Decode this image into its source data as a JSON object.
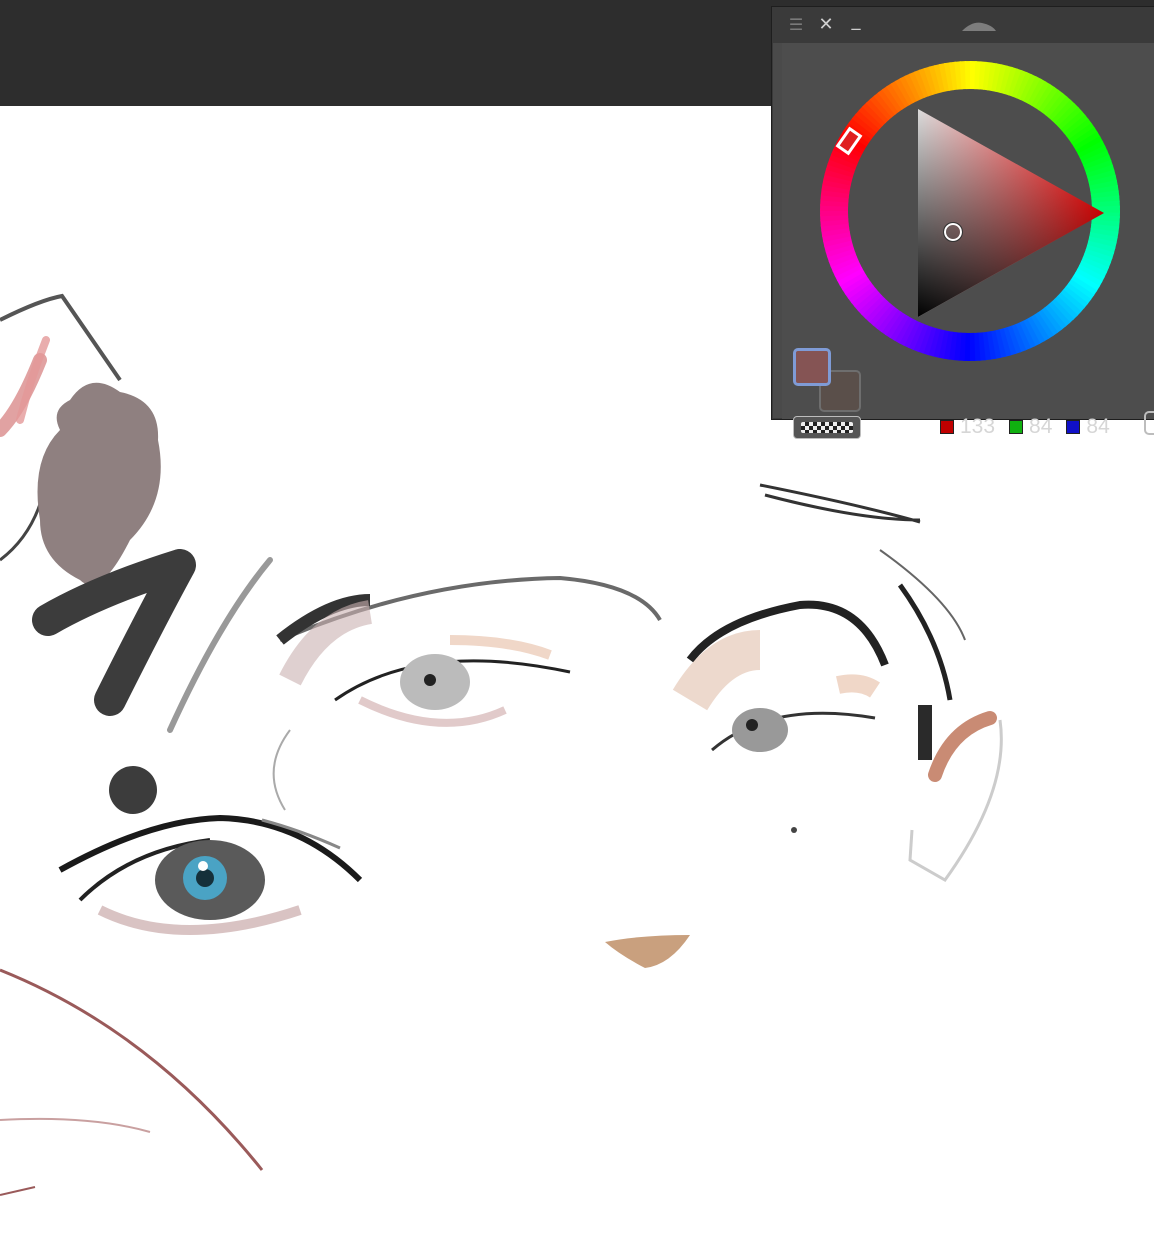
{
  "panel": {
    "header": {
      "menu_icon": "hamburger-icon",
      "close_glyph": "✕",
      "minimize_glyph": "_"
    },
    "color": {
      "foreground_hex": "#855454",
      "background_hex": "#5a4f4a",
      "hue_marker_color": "#e02020",
      "red": "133",
      "green": "84",
      "blue": "84",
      "red_chip": "#c00000",
      "green_chip": "#10b010",
      "blue_chip": "#1010c8"
    }
  }
}
